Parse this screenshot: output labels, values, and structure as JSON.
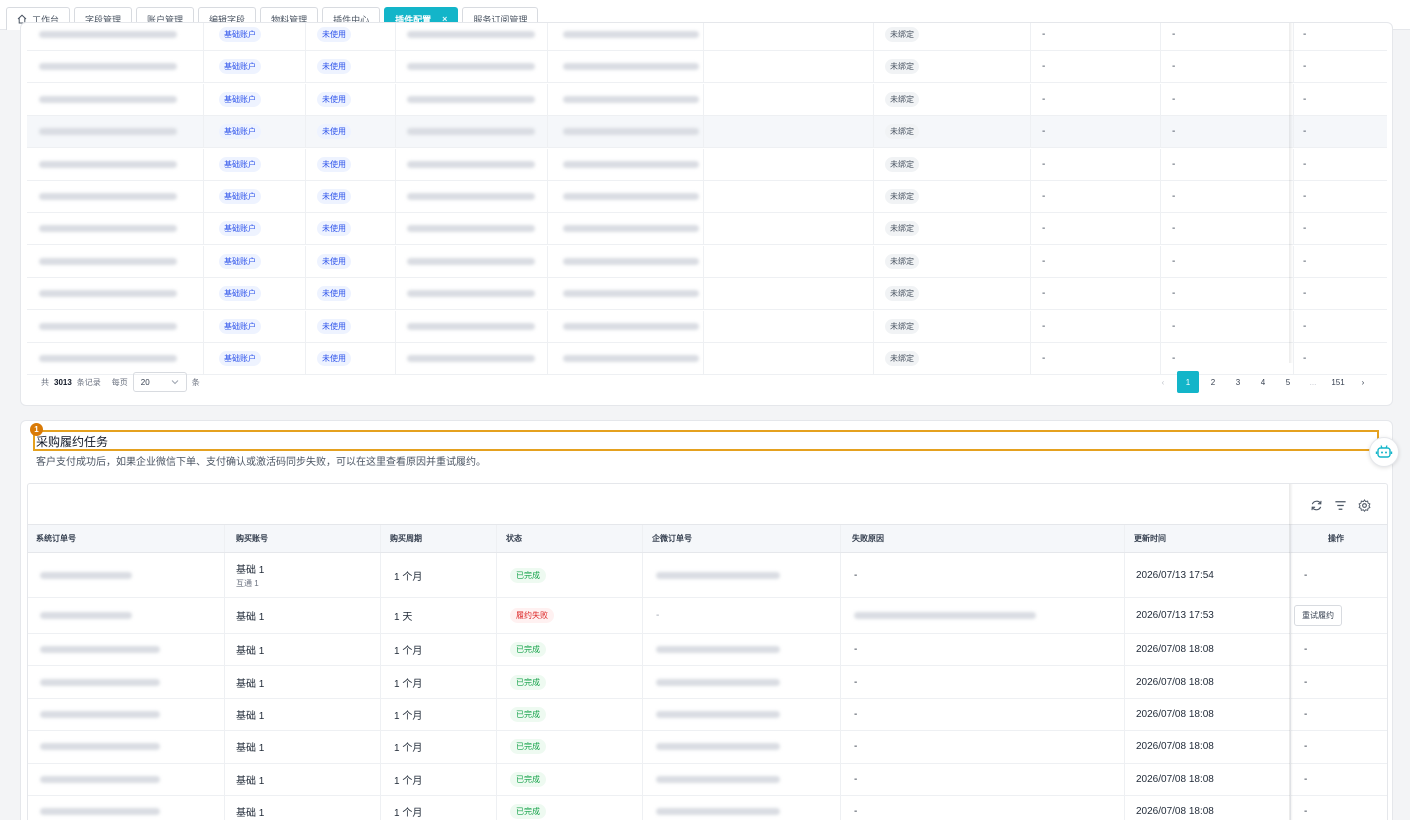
{
  "tabs": [
    {
      "label": "工作台",
      "icon": "home-icon"
    },
    {
      "label": "字段管理"
    },
    {
      "label": "账户管理"
    },
    {
      "label": "编辑字段"
    },
    {
      "label": "物料管理"
    },
    {
      "label": "插件中心"
    },
    {
      "label": "插件配置",
      "active": true,
      "close": "×"
    },
    {
      "label": "服务订阅管理"
    }
  ],
  "table1": {
    "rows": [
      {
        "type": "基础账户",
        "use": "未使用",
        "bind": "未绑定",
        "c1": "-",
        "c2": "-",
        "c3": "-"
      },
      {
        "type": "基础账户",
        "use": "未使用",
        "bind": "未绑定",
        "c1": "-",
        "c2": "-",
        "c3": "-"
      },
      {
        "type": "基础账户",
        "use": "未使用",
        "bind": "未绑定",
        "c1": "-",
        "c2": "-",
        "c3": "-"
      },
      {
        "type": "基础账户",
        "use": "未使用",
        "bind": "未绑定",
        "c1": "-",
        "c2": "-",
        "c3": "-"
      },
      {
        "type": "基础账户",
        "use": "未使用",
        "bind": "未绑定",
        "c1": "-",
        "c2": "-",
        "c3": "-"
      },
      {
        "type": "基础账户",
        "use": "未使用",
        "bind": "未绑定",
        "c1": "-",
        "c2": "-",
        "c3": "-"
      },
      {
        "type": "基础账户",
        "use": "未使用",
        "bind": "未绑定",
        "c1": "-",
        "c2": "-",
        "c3": "-"
      },
      {
        "type": "基础账户",
        "use": "未使用",
        "bind": "未绑定",
        "c1": "-",
        "c2": "-",
        "c3": "-"
      },
      {
        "type": "基础账户",
        "use": "未使用",
        "bind": "未绑定",
        "c1": "-",
        "c2": "-",
        "c3": "-"
      },
      {
        "type": "基础账户",
        "use": "未使用",
        "bind": "未绑定",
        "c1": "-",
        "c2": "-",
        "c3": "-"
      },
      {
        "type": "基础账户",
        "use": "未使用",
        "bind": "未绑定",
        "c1": "-",
        "c2": "-",
        "c3": "-"
      }
    ]
  },
  "pager": {
    "total_prefix": "共",
    "total": "3013",
    "total_suffix": "条记录",
    "per_page_label": "每页",
    "page_size": "20",
    "unit": "条",
    "prev": "‹",
    "pages": [
      "1",
      "2",
      "3",
      "4",
      "5",
      "...",
      "151"
    ],
    "next": "›"
  },
  "section": {
    "badge": "1",
    "title": "采购履约任务",
    "description": "客户支付成功后，如果企业微信下单、支付确认或激活码同步失败，可以在这里查看原因并重试履约。"
  },
  "toolbar_icons": [
    "refresh-icon",
    "density-icon",
    "settings-icon"
  ],
  "table2": {
    "headers": [
      "系统订单号",
      "购买账号",
      "购买周期",
      "状态",
      "企微订单号",
      "失败原因",
      "更新时间",
      "操作"
    ],
    "rows": [
      {
        "account": "基础 1",
        "account_sub": "互通 1",
        "period": "1 个月",
        "status": "已完成",
        "status_type": "ok",
        "reason": "-",
        "time": "2026/07/13 17:54",
        "op": "-"
      },
      {
        "account": "基础 1",
        "account_sub": "",
        "period": "1 天",
        "status": "履约失败",
        "status_type": "fail",
        "reason": "",
        "time": "2026/07/13 17:53",
        "op": "重试履约",
        "wx_order": "-"
      },
      {
        "account": "基础 1",
        "account_sub": "",
        "period": "1 个月",
        "status": "已完成",
        "status_type": "ok",
        "reason": "-",
        "time": "2026/07/08 18:08",
        "op": "-"
      },
      {
        "account": "基础 1",
        "account_sub": "",
        "period": "1 个月",
        "status": "已完成",
        "status_type": "ok",
        "reason": "-",
        "time": "2026/07/08 18:08",
        "op": "-"
      },
      {
        "account": "基础 1",
        "account_sub": "",
        "period": "1 个月",
        "status": "已完成",
        "status_type": "ok",
        "reason": "-",
        "time": "2026/07/08 18:08",
        "op": "-"
      },
      {
        "account": "基础 1",
        "account_sub": "",
        "period": "1 个月",
        "status": "已完成",
        "status_type": "ok",
        "reason": "-",
        "time": "2026/07/08 18:08",
        "op": "-"
      },
      {
        "account": "基础 1",
        "account_sub": "",
        "period": "1 个月",
        "status": "已完成",
        "status_type": "ok",
        "reason": "-",
        "time": "2026/07/08 18:08",
        "op": "-"
      },
      {
        "account": "基础 1",
        "account_sub": "",
        "period": "1 个月",
        "status": "已完成",
        "status_type": "ok",
        "reason": "-",
        "time": "2026/07/08 18:08",
        "op": "-"
      }
    ]
  },
  "assistant_icon": "robot-icon",
  "colors": {
    "accent": "#13b5c9",
    "focus": "#e5a11f",
    "success": "#16a34a",
    "danger": "#dc2626"
  }
}
